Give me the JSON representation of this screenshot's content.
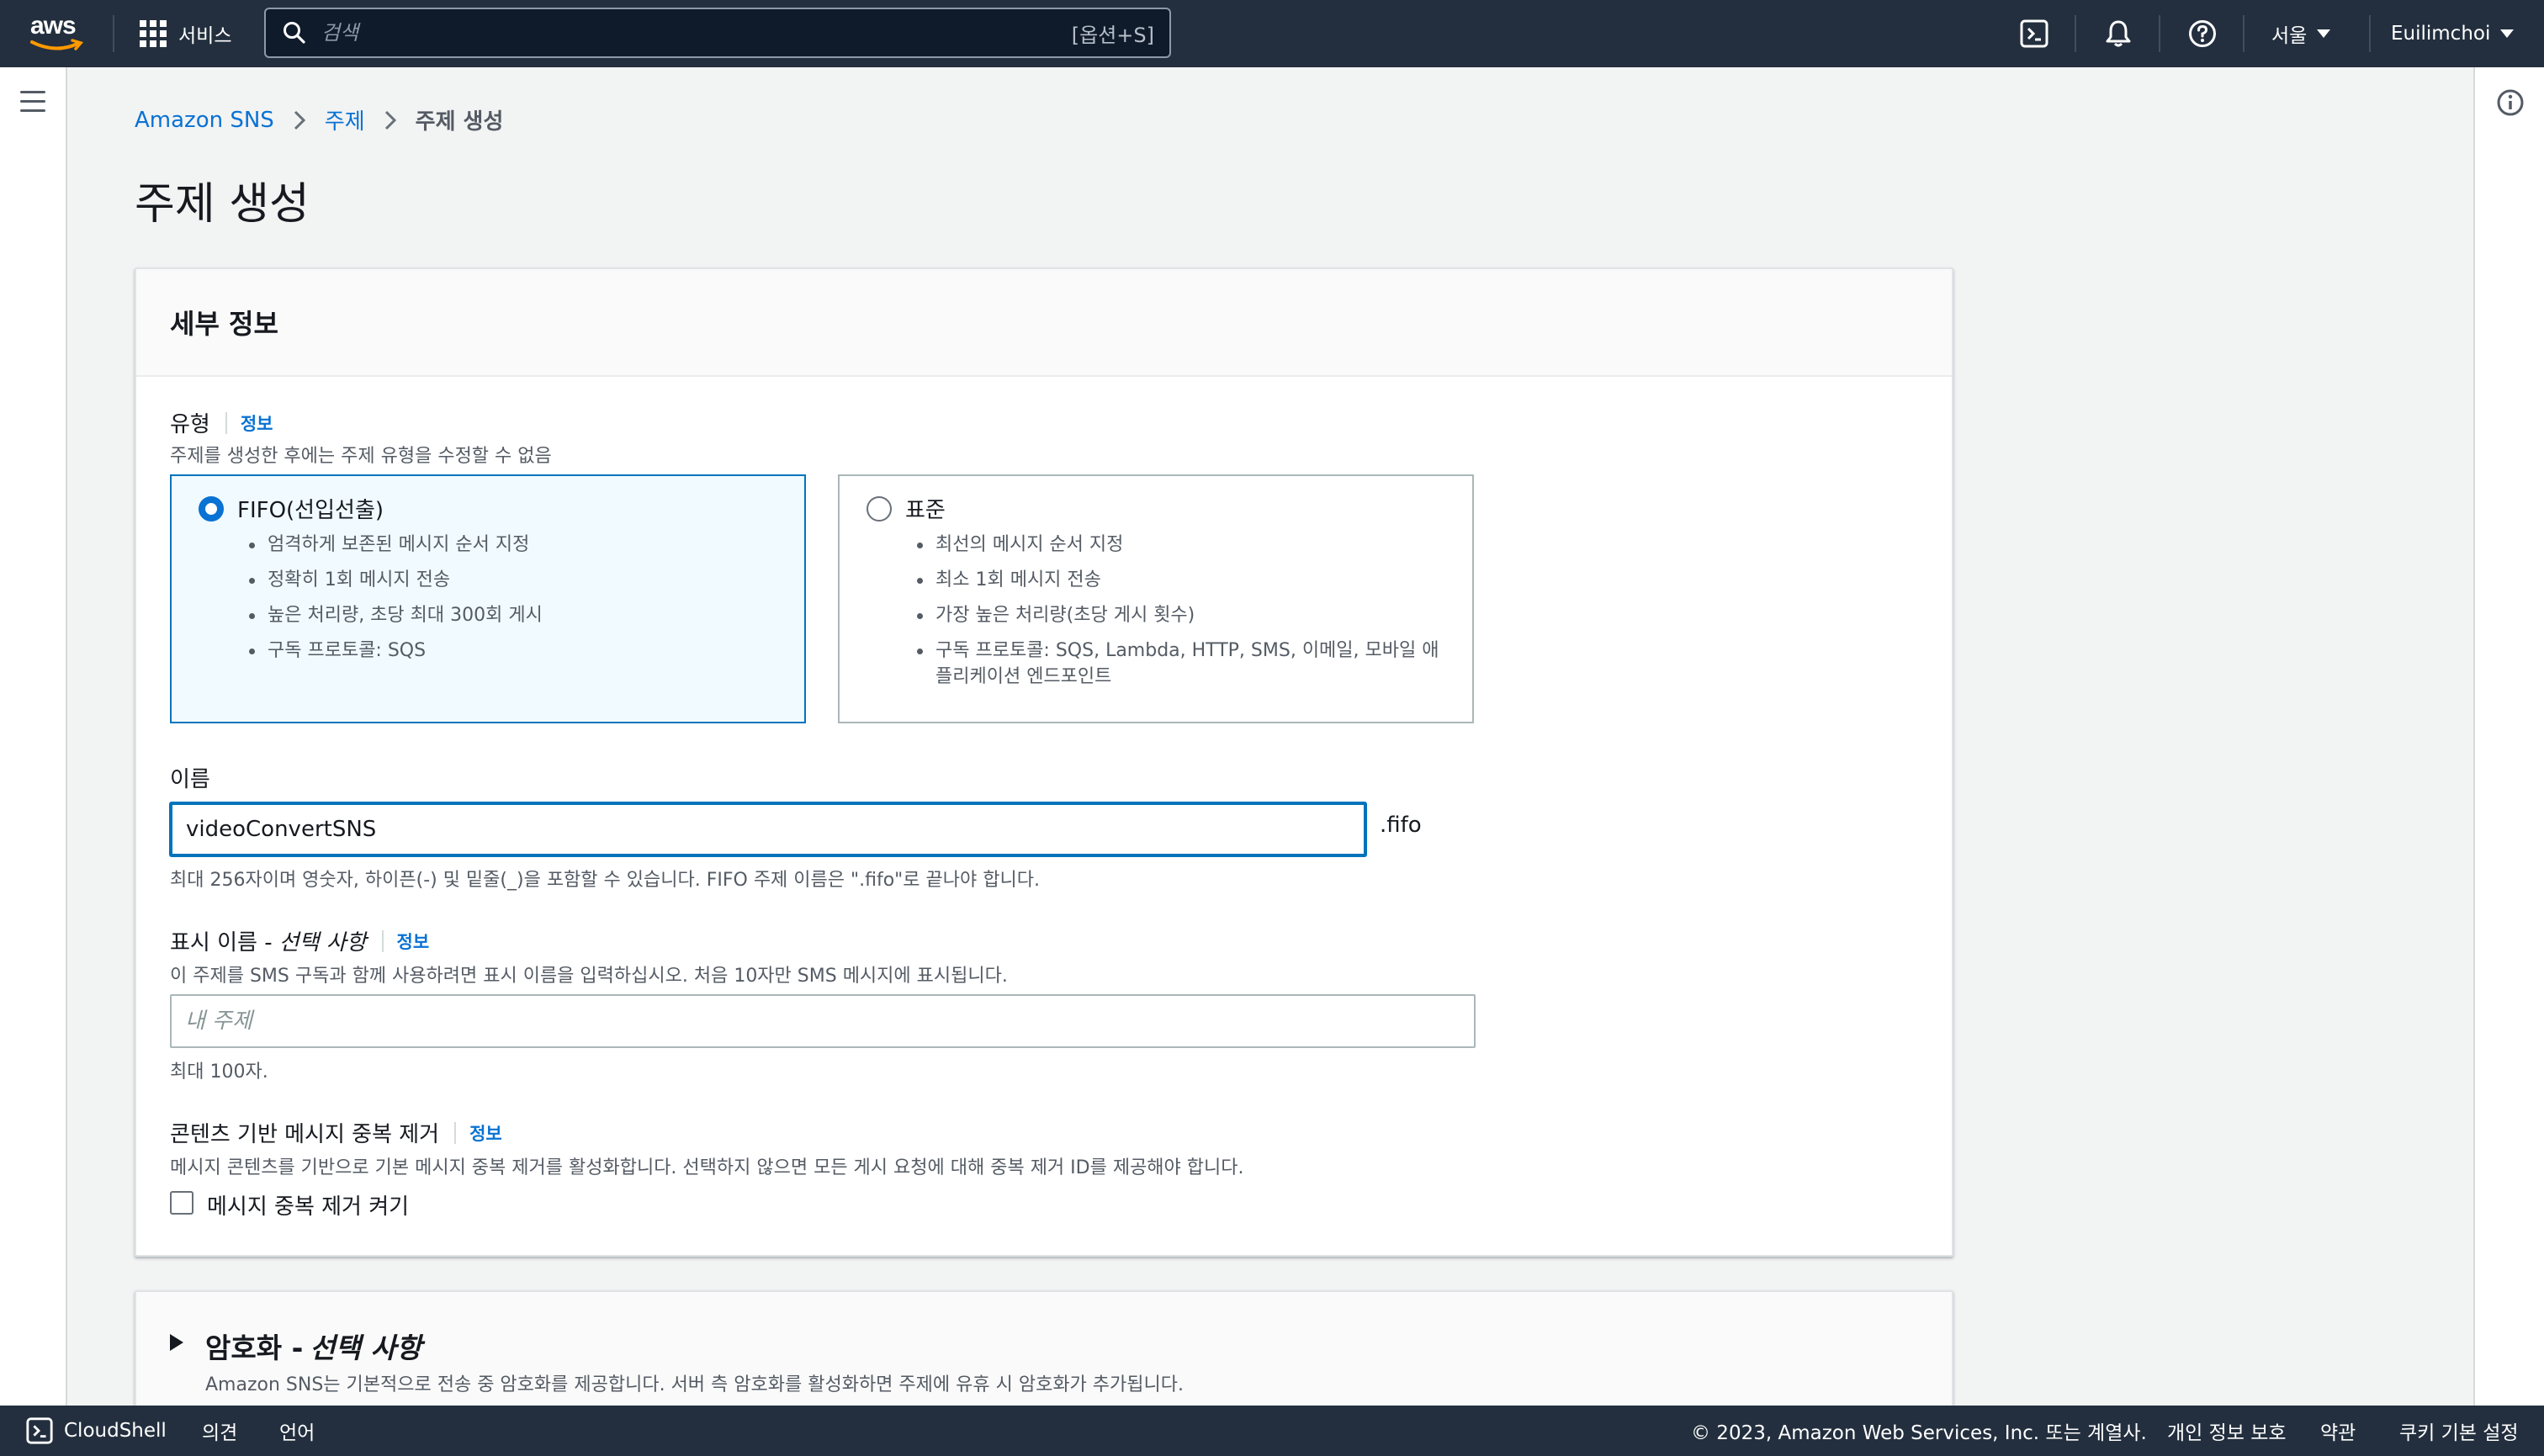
{
  "nav": {
    "services_label": "서비스",
    "search_placeholder": "검색",
    "search_shortcut": "[옵션+S]",
    "region": "서울",
    "user": "Euilimchoi"
  },
  "breadcrumb": {
    "items": [
      "Amazon SNS",
      "주제"
    ],
    "current": "주제 생성"
  },
  "page": {
    "title": "주제 생성"
  },
  "details": {
    "header": "세부 정보",
    "type": {
      "label": "유형",
      "info": "정보",
      "description": "주제를 생성한 후에는 주제 유형을 수정할 수 없음",
      "options": [
        {
          "title": "FIFO(선입선출)",
          "selected": true,
          "bullets": [
            "엄격하게 보존된 메시지 순서 지정",
            "정확히 1회 메시지 전송",
            "높은 처리량, 초당 최대 300회 게시",
            "구독 프로토콜: SQS"
          ]
        },
        {
          "title": "표준",
          "selected": false,
          "bullets": [
            "최선의 메시지 순서 지정",
            "최소 1회 메시지 전송",
            "가장 높은 처리량(초당 게시 횟수)",
            "구독 프로토콜: SQS, Lambda, HTTP, SMS, 이메일, 모바일 애플리케이션 엔드포인트"
          ]
        }
      ]
    },
    "name": {
      "label": "이름",
      "value": "videoConvertSNS",
      "suffix": ".fifo",
      "hint": "최대 256자이며 영숫자, 하이픈(-) 및 밑줄(_)을 포함할 수 있습니다. FIFO 주제 이름은 \".fifo\"로 끝나야 합니다."
    },
    "display_name": {
      "label": "표시 이름 -",
      "optional": "선택 사항",
      "info": "정보",
      "description": "이 주제를 SMS 구독과 함께 사용하려면 표시 이름을 입력하십시오. 처음 10자만 SMS 메시지에 표시됩니다.",
      "placeholder": "내 주제",
      "hint": "최대 100자."
    },
    "dedup": {
      "label": "콘텐츠 기반 메시지 중복 제거",
      "info": "정보",
      "description": "메시지 콘텐츠를 기반으로 기본 메시지 중복 제거를 활성화합니다. 선택하지 않으면 모든 게시 요청에 대해 중복 제거 ID를 제공해야 합니다.",
      "checkbox_label": "메시지 중복 제거 켜기"
    }
  },
  "encryption": {
    "title": "암호화 -",
    "optional": "선택 사항",
    "description": "Amazon SNS는 기본적으로 전송 중 암호화를 제공합니다. 서버 측 암호화를 활성화하면 주제에 유휴 시 암호화가 추가됩니다."
  },
  "footer": {
    "cloudshell": "CloudShell",
    "feedback": "의견",
    "language": "언어",
    "copyright": "© 2023, Amazon Web Services, Inc. 또는 계열사.",
    "privacy": "개인 정보 보호",
    "terms": "약관",
    "cookies": "쿠키 기본 설정"
  },
  "colors": {
    "nav_bg": "#232f3e",
    "link": "#0972d3",
    "selected_tile_bg": "#f1faff",
    "focus_border": "#0073bb"
  },
  "icons": [
    "aws-logo",
    "grid-icon",
    "search-icon",
    "cloudshell-icon",
    "bell-icon",
    "help-icon",
    "menu-icon",
    "info-icon",
    "chevron-right-icon",
    "caret-down-icon",
    "expand-arrow-icon"
  ]
}
